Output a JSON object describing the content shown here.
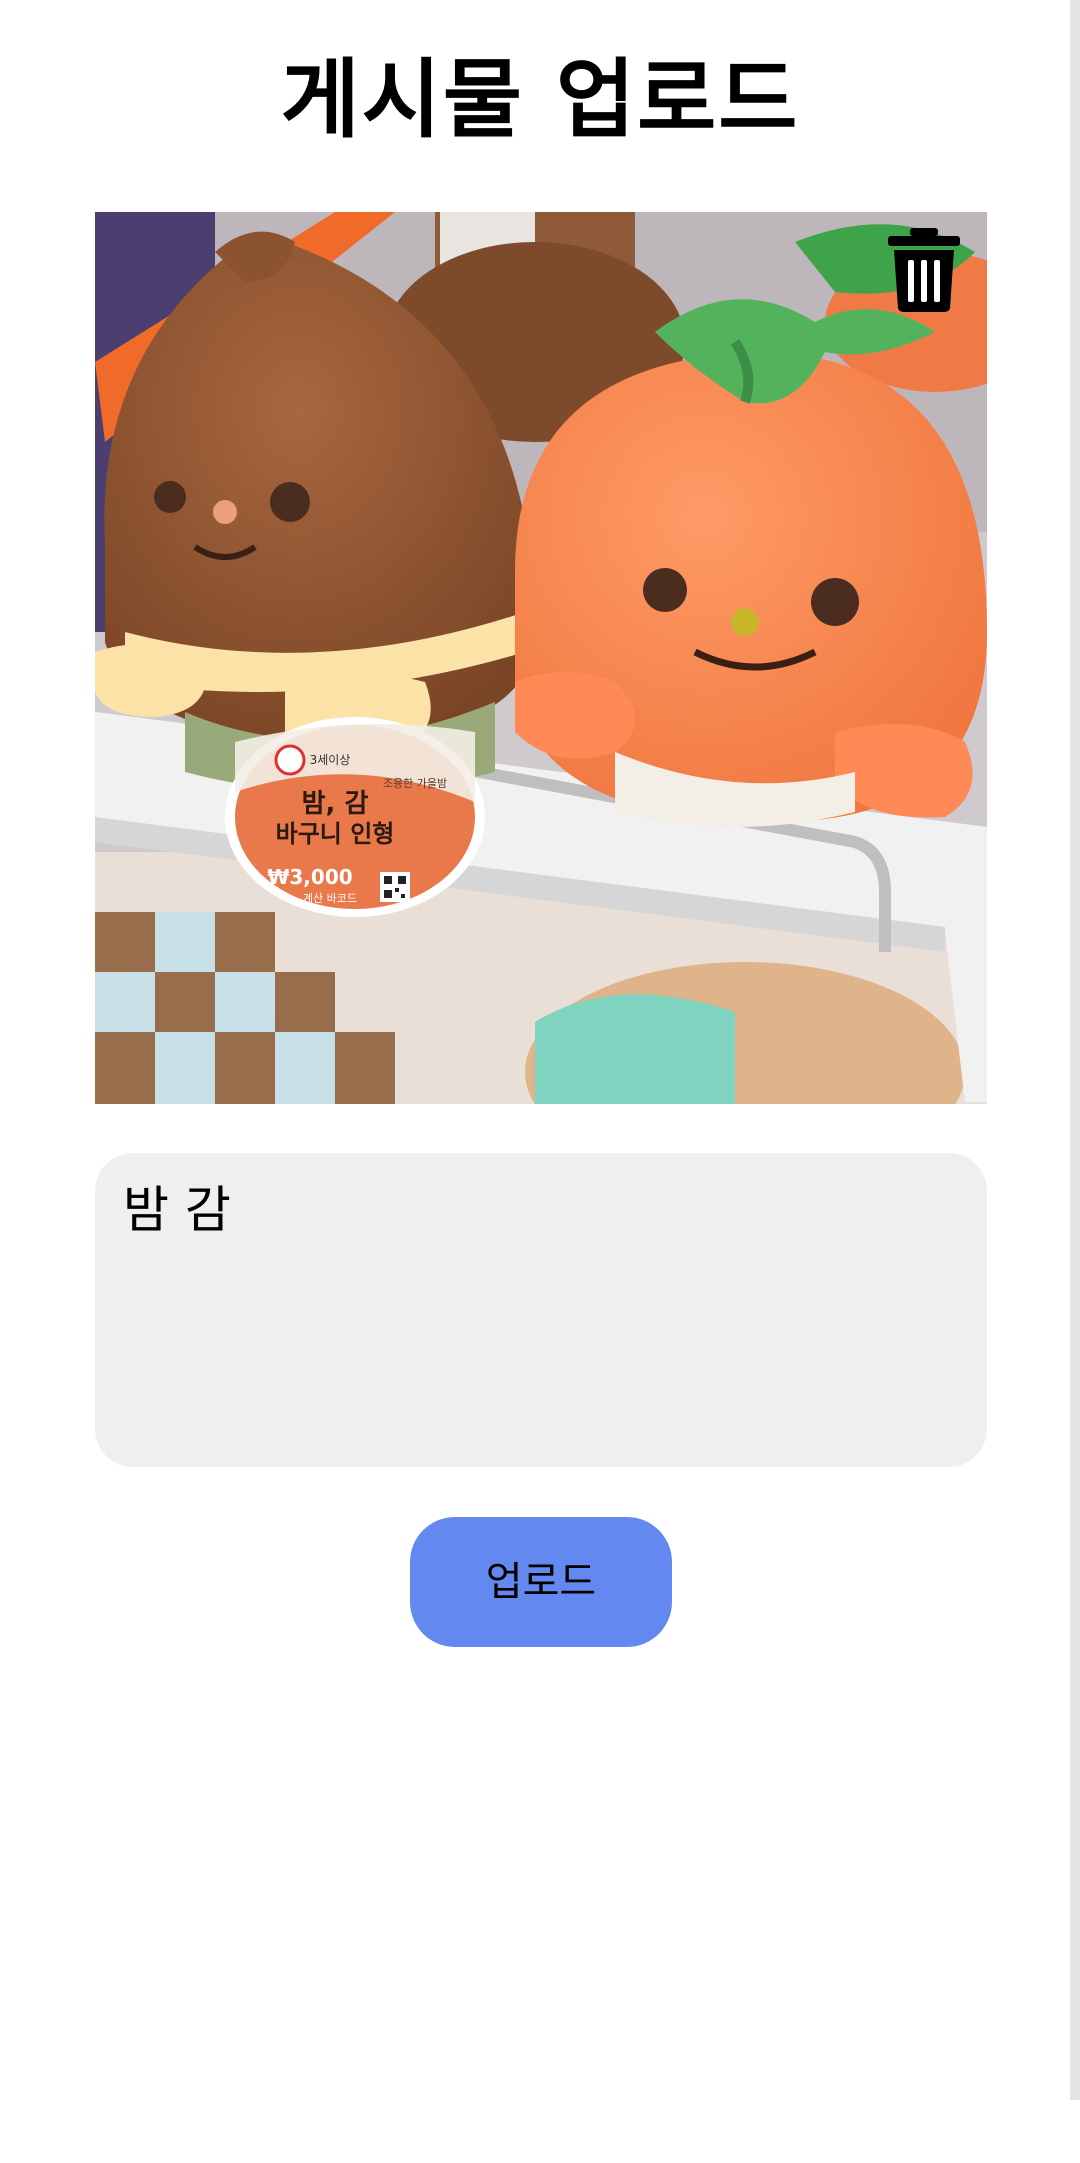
{
  "page": {
    "title": "게시물 업로드"
  },
  "photo": {
    "subject": "chestnut-and-persimmon-plush-toys",
    "tag": {
      "line1": "밤, 감",
      "line2": "바구니 인형",
      "price": "₩3,000",
      "barcode_label": "계산 바코드",
      "age_badge": "3세이상",
      "side_note": "조용한 가을밤"
    }
  },
  "delete": {
    "icon": "trash-icon"
  },
  "caption": {
    "value": "밤 감"
  },
  "actions": {
    "upload_label": "업로드"
  },
  "colors": {
    "accent": "#6389f0",
    "input_bg": "#efefef"
  }
}
